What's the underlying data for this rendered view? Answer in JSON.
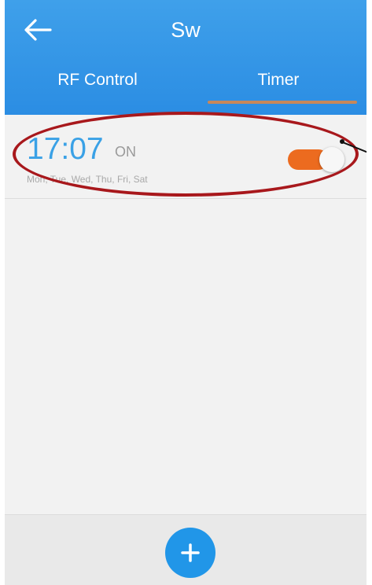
{
  "header": {
    "title": "Sw",
    "back_icon": "arrow-left-icon",
    "tabs": [
      {
        "label": "RF Control",
        "active": false
      },
      {
        "label": "Timer",
        "active": true
      }
    ]
  },
  "timers": [
    {
      "time": "17:07",
      "state": "ON",
      "days": "Mon, Tue, Wed, Thu, Fri, Sat",
      "enabled": true
    }
  ],
  "footer": {
    "add_icon": "plus-icon"
  },
  "colors": {
    "header": "#2b8de3",
    "accent_time": "#3aa1e6",
    "toggle_on": "#ec6b1f",
    "annotation": "#a8181c",
    "fab": "#2196e8"
  }
}
